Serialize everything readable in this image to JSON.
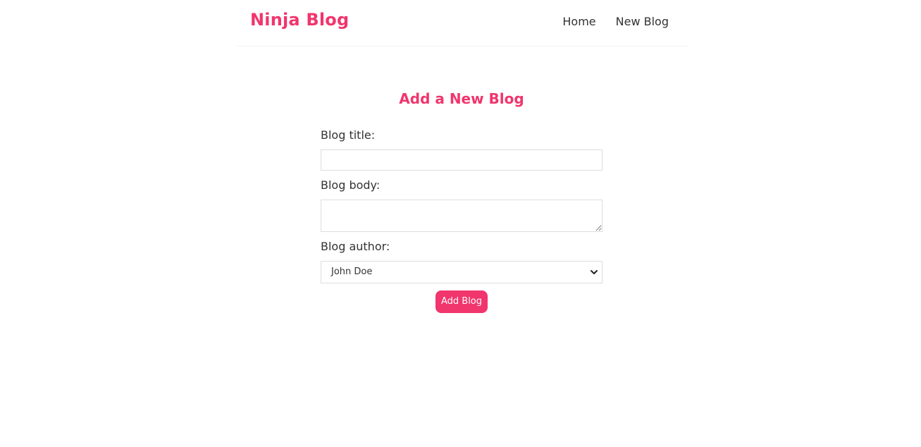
{
  "navbar": {
    "brand": "Ninja Blog",
    "links": [
      {
        "label": "Home"
      },
      {
        "label": "New Blog"
      }
    ]
  },
  "create": {
    "heading": "Add a New Blog",
    "title_label": "Blog title:",
    "title_value": "",
    "body_label": "Blog body:",
    "body_value": "",
    "author_label": "Blog author:",
    "author_selected": "John Doe",
    "submit_label": "Add Blog"
  },
  "colors": {
    "accent": "#f1356d",
    "text": "#333333",
    "border": "#dddddd"
  },
  "icons": {
    "select_arrow": "chevron-down-icon"
  }
}
